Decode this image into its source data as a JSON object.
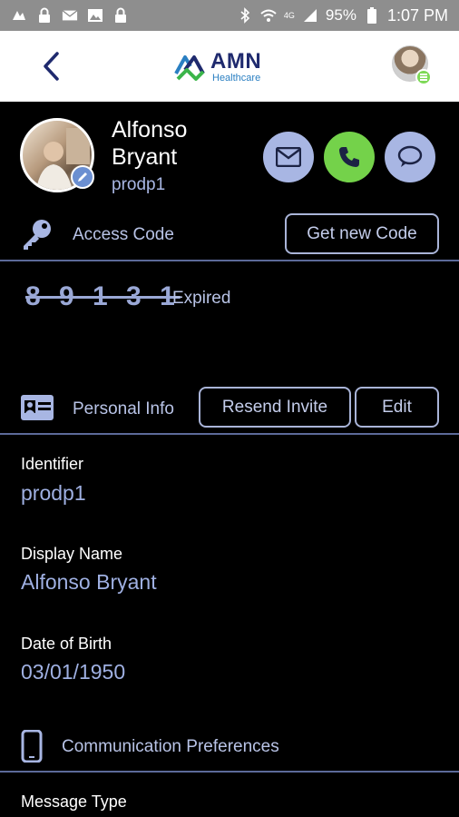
{
  "status_bar": {
    "battery": "95%",
    "time": "1:07 PM",
    "network": "4G"
  },
  "header": {
    "logo_primary": "AMN",
    "logo_secondary": "Healthcare"
  },
  "profile": {
    "first_name": "Alfonso",
    "last_name": "Bryant",
    "identifier": "prodp1"
  },
  "access_code": {
    "label": "Access Code",
    "button": "Get new Code",
    "code": "8 9 1 3 1",
    "status": "Expired"
  },
  "personal_info": {
    "label": "Personal Info",
    "resend_button": "Resend Invite",
    "edit_button": "Edit",
    "fields": [
      {
        "label": "Identifier",
        "value": "prodp1"
      },
      {
        "label": "Display Name",
        "value": "Alfonso Bryant"
      },
      {
        "label": "Date of Birth",
        "value": "03/01/1950"
      }
    ]
  },
  "communication": {
    "label": "Communication Preferences",
    "message_type_label": "Message Type"
  },
  "colors": {
    "accent": "#a8b6e3",
    "call_green": "#74d24a",
    "divider": "#5c6a99",
    "value_text": "#9fb0e2"
  },
  "icons": [
    "back-icon",
    "mail-icon",
    "phone-icon",
    "chat-icon",
    "key-icon",
    "id-card-icon",
    "mobile-phone-icon",
    "edit-pencil-icon"
  ]
}
